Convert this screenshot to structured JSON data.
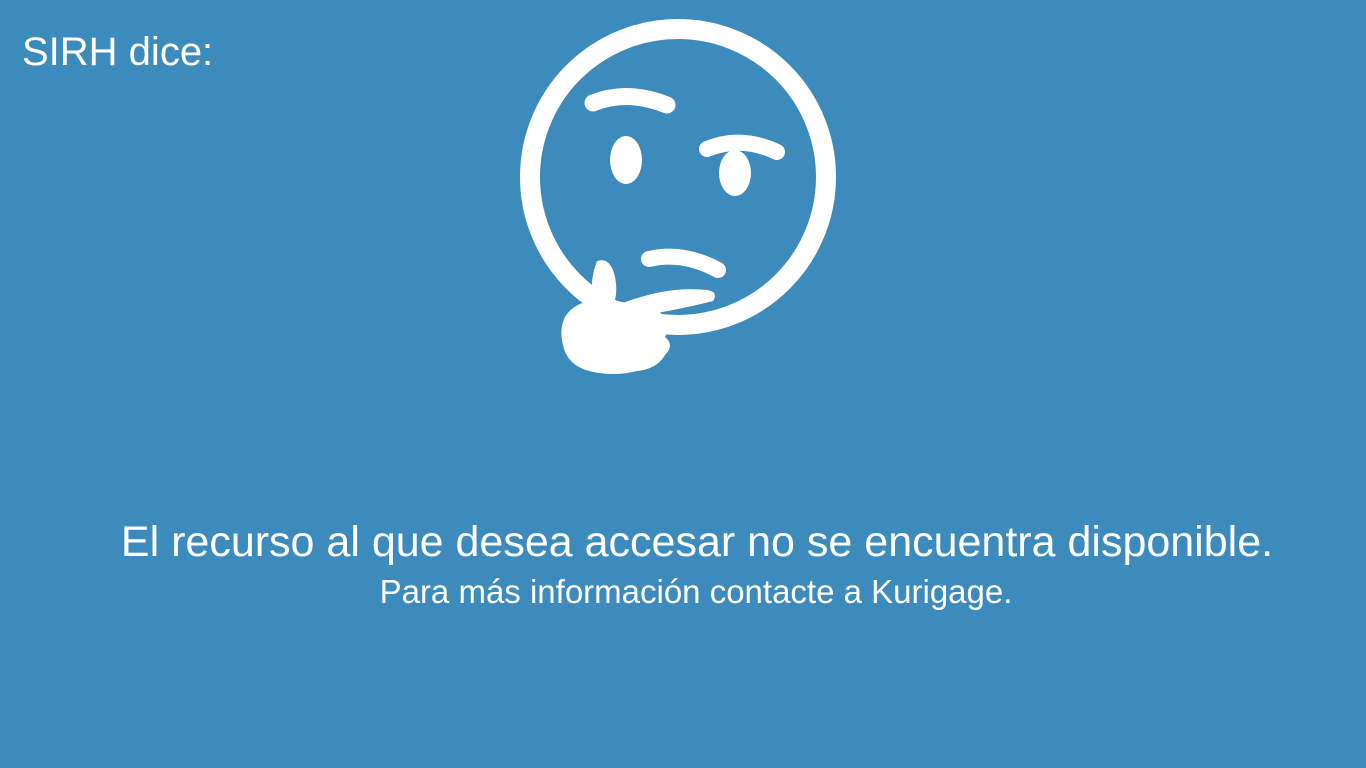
{
  "header": {
    "title": "SIRH dice:"
  },
  "illustration": {
    "icon": "thinking-face-icon",
    "color": "#ffffff"
  },
  "message": {
    "main": "El recurso al que desea accesar no se encuentra disponible.",
    "sub": "Para más información contacte a Kurigage."
  },
  "colors": {
    "background": "#3d8bbd",
    "foreground": "#ffffff"
  }
}
